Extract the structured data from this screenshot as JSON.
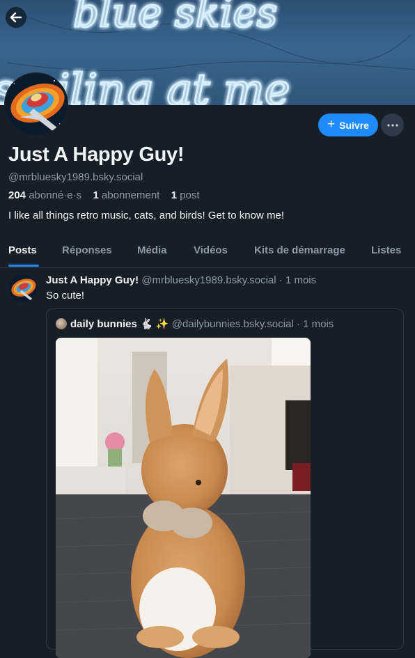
{
  "banner": {
    "neon_line_1": "blue skies",
    "neon_line_2": "smiling at me"
  },
  "profile": {
    "display_name": "Just A Happy Guy!",
    "handle": "@mrbluesky1989.bsky.social",
    "followers_count": "204",
    "followers_label": "abonné·e·s",
    "following_count": "1",
    "following_label": "abonnement",
    "posts_count": "1",
    "posts_label": "post",
    "bio": "I like all things retro music, cats, and birds! Get to know me!"
  },
  "actions": {
    "follow_label": "Suivre",
    "more_icon": "more-horizontal-icon"
  },
  "tabs": [
    {
      "label": "Posts",
      "active": true
    },
    {
      "label": "Réponses",
      "active": false
    },
    {
      "label": "Média",
      "active": false
    },
    {
      "label": "Vidéos",
      "active": false
    },
    {
      "label": "Kits de démarrage",
      "active": false
    },
    {
      "label": "Listes",
      "active": false
    }
  ],
  "post": {
    "author": "Just A Happy Guy!",
    "handle": "@mrbluesky1989.bsky.social",
    "time": "· 1 mois",
    "text": "So cute!",
    "quote": {
      "author": "daily bunnies 🐇 ✨",
      "handle": "@dailybunnies.bsky.social",
      "time": "· 1 mois"
    }
  },
  "colors": {
    "background": "#161e27",
    "accent": "#208bfe",
    "muted_text": "#8d9aa8",
    "border": "#2e3a47"
  }
}
